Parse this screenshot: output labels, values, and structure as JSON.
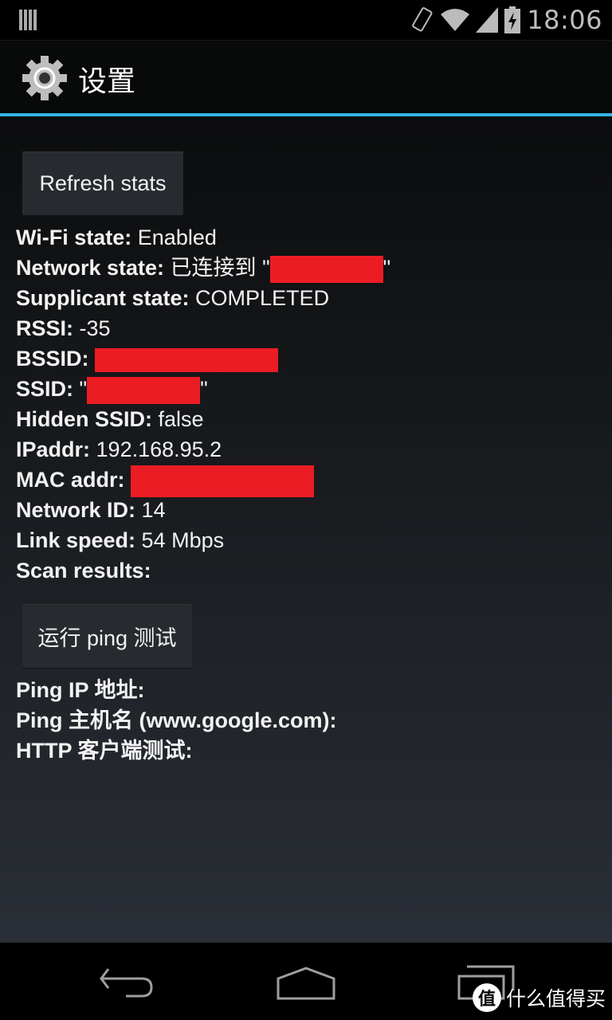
{
  "status_bar": {
    "time": "18:06",
    "icons": [
      "notification-bars-icon",
      "vibrate-icon",
      "wifi-icon",
      "signal-icon",
      "battery-charging-icon"
    ]
  },
  "action_bar": {
    "icon": "gear-icon",
    "title": "设置"
  },
  "buttons": {
    "refresh": "Refresh stats",
    "ping": "运行 ping 测试"
  },
  "stats": [
    {
      "label": "Wi-Fi state:",
      "value": "Enabled"
    },
    {
      "label": "Network state:",
      "value": "已连接到 \"",
      "redacted": true,
      "suffix": "\""
    },
    {
      "label": "Supplicant state:",
      "value": "COMPLETED"
    },
    {
      "label": "RSSI:",
      "value": "-35"
    },
    {
      "label": "BSSID:",
      "value": "",
      "redacted": true
    },
    {
      "label": "SSID:",
      "value": "\"",
      "redacted": true,
      "suffix": "\""
    },
    {
      "label": "Hidden SSID:",
      "value": "false"
    },
    {
      "label": "IPaddr:",
      "value": "192.168.95.2"
    },
    {
      "label": "MAC addr:",
      "value": "",
      "redacted": true
    },
    {
      "label": "Network ID:",
      "value": "14"
    },
    {
      "label": "Link speed:",
      "value": "54 Mbps"
    },
    {
      "label": "Scan results:",
      "value": ""
    }
  ],
  "ping_results": [
    {
      "label": "Ping IP 地址:"
    },
    {
      "label": "Ping 主机名 (www.google.com):"
    },
    {
      "label": "HTTP 客户端测试:"
    }
  ],
  "nav_bar": {
    "back": "back-icon",
    "home": "home-icon",
    "recents": "recents-icon"
  },
  "watermark": {
    "logo_char": "值",
    "text": "什么值得买"
  },
  "colors": {
    "accent": "#33b5e5",
    "redaction": "#ec1c24"
  }
}
